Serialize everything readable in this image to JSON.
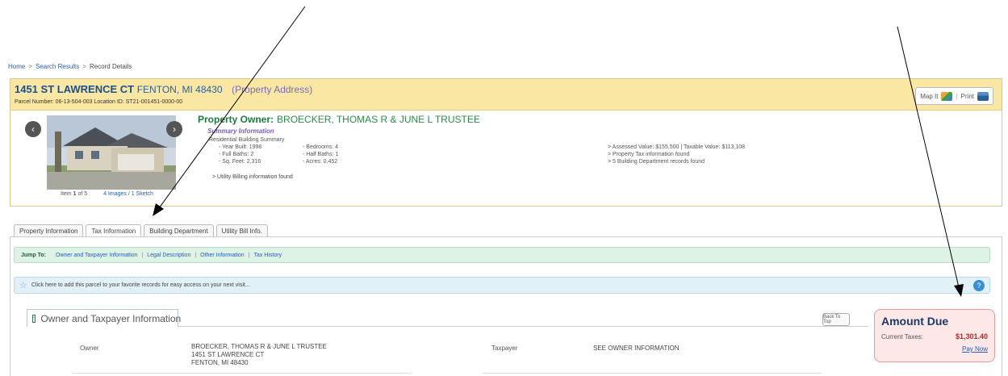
{
  "breadcrumb": {
    "home": "Home",
    "search_results": "Search Results",
    "current": "Record Details",
    "separator": ">"
  },
  "record": {
    "address_street": "1451 ST LAWRENCE CT",
    "address_city": "FENTON, MI 48430",
    "address_note": "(Property Address)",
    "parcel_line": "Parcel Number: 06-13-504-003 Location ID: ST21-001451-0000-00",
    "map_it": "Map It",
    "print": "Print",
    "owner_label": "Property Owner:",
    "owner_name": "BROECKER, THOMAS R & JUNE L TRUSTEE",
    "summary_heading": "Summary Information",
    "building_summary": "Residential Building Summary",
    "year_built": "-  Year Built: 1998",
    "full_baths": "-  Full Baths: 2",
    "sq_feet": "-  Sq. Feet: 2,316",
    "bedrooms": "-  Bedrooms: 4",
    "half_baths": "-  Half Baths: 1",
    "acres": "-  Acres: 0.452",
    "utility_billing": ">  Utility Billing information found",
    "assessed": ">  Assessed Value: $155,500 | Taxable Value: $113,108",
    "tax_info": ">  Property Tax information found",
    "building_dept": ">  5 Building Department records found",
    "item_prefix": "Item",
    "item_num": "1",
    "item_suffix": "of 5",
    "images_link": "4 Images / 1 Sketch"
  },
  "tabs": [
    {
      "label": "Property Information"
    },
    {
      "label": "Tax Information"
    },
    {
      "label": "Building Department"
    },
    {
      "label": "Utility Bill Info."
    }
  ],
  "jump": {
    "label": "Jump To:",
    "links": [
      "Owner and Taxpayer Information",
      "Legal Description",
      "Other Information",
      "Tax History"
    ],
    "separator": "|"
  },
  "favorite": {
    "text": "Click here to add this parcel to your favorite records for easy access on your next visit..."
  },
  "section": {
    "title": "Owner and Taxpayer Information",
    "toggle": "-",
    "back_to_top": "Back To Top"
  },
  "owner": {
    "label": "Owner",
    "line1": "BROECKER, THOMAS R & JUNE L TRUSTEE",
    "line2": "1451 ST LAWRENCE CT",
    "line3": "FENTON, MI 48430"
  },
  "taxpayer": {
    "label": "Taxpayer",
    "value": "SEE OWNER INFORMATION"
  },
  "amount_due": {
    "title": "Amount Due",
    "current_label": "Current Taxes:",
    "current_value": "$1,301.40",
    "pay_now": "Pay Now"
  },
  "icons": {
    "map": "map-icon",
    "print": "printer-icon",
    "prev": "chevron-left-icon",
    "next": "chevron-right-icon",
    "star": "star-icon",
    "help": "help-icon"
  }
}
